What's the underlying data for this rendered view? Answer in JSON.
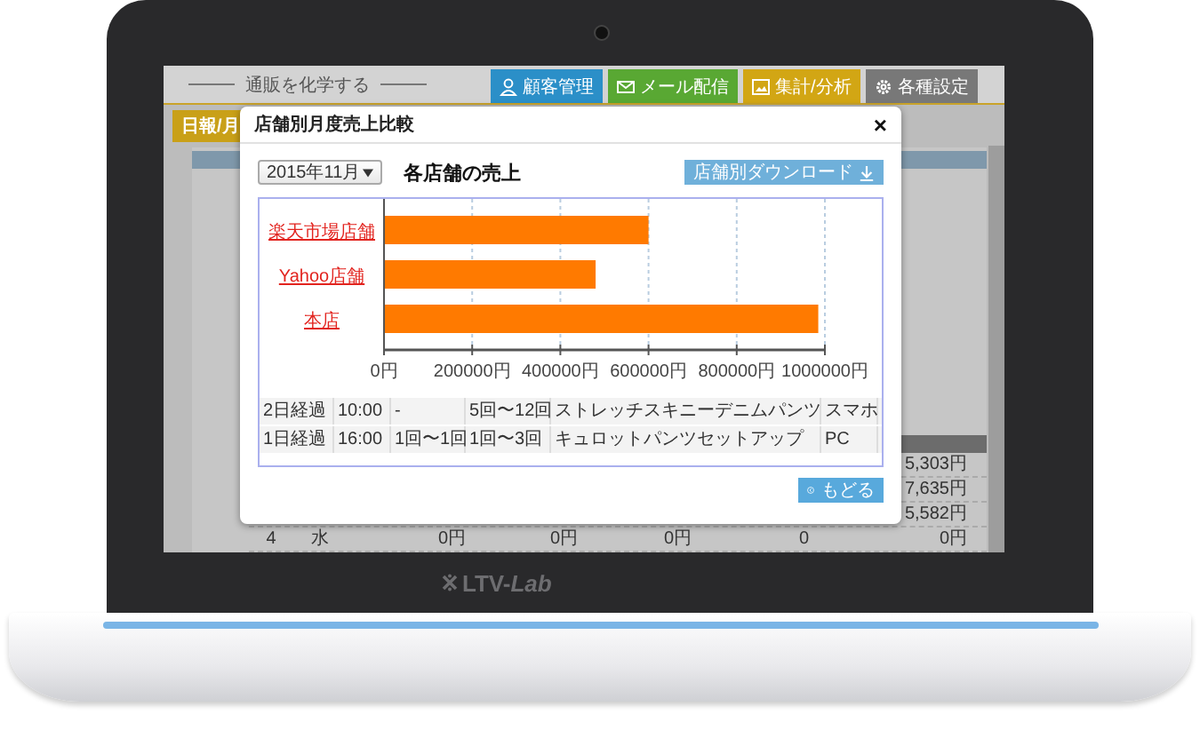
{
  "header": {
    "logo": "通販を化学する",
    "nav": [
      {
        "label": "顧客管理",
        "color": "#2b8fc8"
      },
      {
        "label": "メール配信",
        "color": "#59a833"
      },
      {
        "label": "集計/分析",
        "color": "#d2a614"
      },
      {
        "label": "各種設定",
        "color": "#787878"
      }
    ]
  },
  "subtab": {
    "label": "日報/月"
  },
  "background_table": {
    "rows": [
      {
        "cells": [
          "5,303円"
        ]
      },
      {
        "cells": [
          "7,635円"
        ]
      },
      {
        "cells": [
          "5,582円"
        ]
      },
      {
        "cells": [
          "4",
          "水",
          "0円",
          "0円",
          "0円",
          "0",
          "0円"
        ]
      }
    ]
  },
  "modal": {
    "title": "店舗別月度売上比較",
    "close": "×",
    "month_select": {
      "value": "2015年11月"
    },
    "heading": "各店舗の売上",
    "download_button": "店舗別ダウンロード",
    "chart_data": {
      "type": "bar",
      "orientation": "horizontal",
      "categories": [
        "楽天市場店舗",
        "Yahoo店舗",
        "本店"
      ],
      "values": [
        600000,
        480000,
        985000
      ],
      "xlim": [
        0,
        1000000
      ],
      "xticks": [
        {
          "value": 0,
          "label": "0円"
        },
        {
          "value": 200000,
          "label": "200000円"
        },
        {
          "value": 400000,
          "label": "400000円"
        },
        {
          "value": 600000,
          "label": "600000円"
        },
        {
          "value": 800000,
          "label": "800000円"
        },
        {
          "value": 1000000,
          "label": "1000000円"
        }
      ],
      "color": "#ff7a00",
      "grid": true
    },
    "table": {
      "rows": [
        {
          "cells": [
            "2日経過",
            "10:00",
            "-",
            "5回〜12回",
            "ストレッチスキニーデニムパンツ",
            "スマホ"
          ]
        },
        {
          "cells": [
            "1日経過",
            "16:00",
            "1回〜1回",
            "1回〜3回",
            "キュロットパンツセットアップ",
            "PC"
          ]
        }
      ]
    },
    "back_button": "もどる"
  },
  "laptop": {
    "logo": "LTV-*Lab*"
  }
}
